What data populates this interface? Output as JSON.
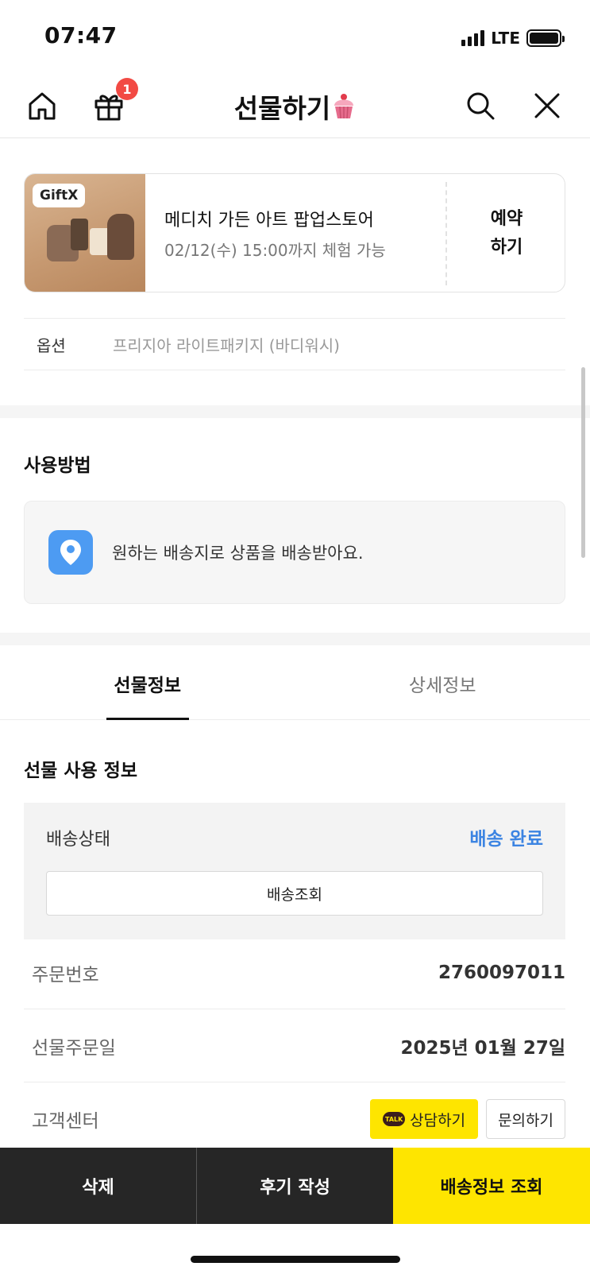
{
  "status_bar": {
    "time": "07:47",
    "network": "LTE"
  },
  "header": {
    "title": "선물하기",
    "gift_badge": "1"
  },
  "product": {
    "tag": "GiftX",
    "name": "메디치 가든 아트 팝업스토어",
    "valid_until": "02/12(수) 15:00까지 체험 가능",
    "reserve_line1": "예약",
    "reserve_line2": "하기"
  },
  "option": {
    "label": "옵션",
    "value": "프리지아 라이트패키지 (바디워시)"
  },
  "howto": {
    "title": "사용방법",
    "text": "원하는 배송지로 상품을 배송받아요."
  },
  "tabs": [
    {
      "label": "선물정보"
    },
    {
      "label": "상세정보"
    }
  ],
  "gift_info": {
    "title": "선물 사용 정보",
    "shipping_label": "배송상태",
    "shipping_status": "배송 완료",
    "track_button": "배송조회",
    "order_number_label": "주문번호",
    "order_number": "2760097011",
    "order_date_label": "선물주문일",
    "order_date": "2025년 01월 27일",
    "cs_label": "고객센터",
    "talk_badge": "TALK",
    "talk_button": "상담하기",
    "inquiry_button": "문의하기"
  },
  "bottom_bar": {
    "delete": "삭제",
    "review": "후기 작성",
    "shipping_info": "배송정보 조회"
  },
  "colors": {
    "accent_blue": "#3c84e2",
    "kakao_yellow": "#fee500",
    "badge_red": "#f24a44",
    "dark_bar": "#262626"
  }
}
